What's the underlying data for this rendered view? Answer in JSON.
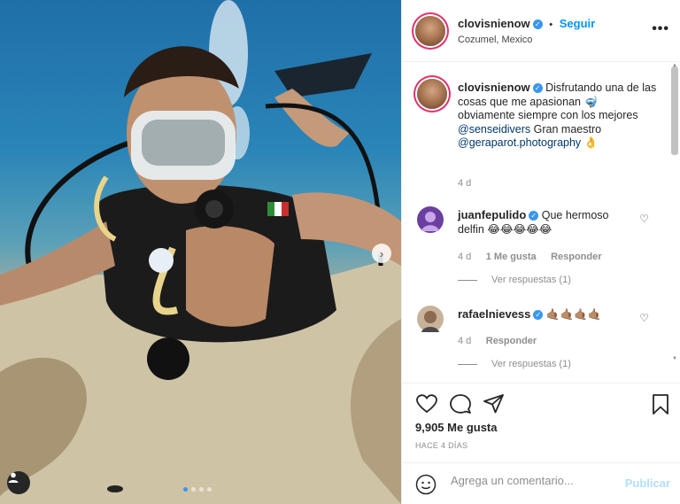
{
  "post": {
    "image_alt": "",
    "carousel": {
      "pages": 4,
      "active_page": 1
    }
  },
  "header": {
    "username": "clovisnienow",
    "follow_sep": "•",
    "follow_label": "Seguir",
    "location": "Cozumel, Mexico",
    "more_label": "•••"
  },
  "caption": {
    "username": "clovisnienow",
    "text_1": " Disfrutando una de las cosas que me apasionan 🤿 obviamente siempre con los mejores ",
    "mention_1": "@senseidivers",
    "text_2": " Gran maestro ",
    "mention_2": "@geraparot.photography",
    "text_3": " 👌",
    "time": "4 d"
  },
  "comments": [
    {
      "username": "juanfepulido",
      "text": " Que hermoso delfin 😂😂😂😂😂",
      "time": "4 d",
      "likes": "1 Me gusta",
      "reply": "Responder",
      "view_replies": "Ver respuestas (1)",
      "avatar_color": "#6b3fa0"
    },
    {
      "username": "rafaelnievess",
      "text": " 🤙🏽🤙🏽🤙🏽🤙🏽",
      "time": "4 d",
      "reply": "Responder",
      "view_replies": "Ver respuestas (1)",
      "avatar_color": "#c9b29a"
    }
  ],
  "actions": {
    "likes": "9,905 Me gusta",
    "posted_ago": "HACE 4 DÍAS"
  },
  "add_comment": {
    "placeholder": "Agrega un comentario...",
    "publish_label": "Publicar"
  },
  "icons": {
    "like": "heart-icon",
    "comment": "comment-icon",
    "share": "paper-plane-icon",
    "save": "bookmark-icon",
    "emoji": "smiley-icon",
    "tag": "user-tag-icon",
    "next": "chevron-right-icon"
  },
  "colors": {
    "link": "#0095f6",
    "mention": "#00376b",
    "muted": "#8e8e8e",
    "story_ring": "#e0326c",
    "publish_disabled": "#b2dffc"
  }
}
